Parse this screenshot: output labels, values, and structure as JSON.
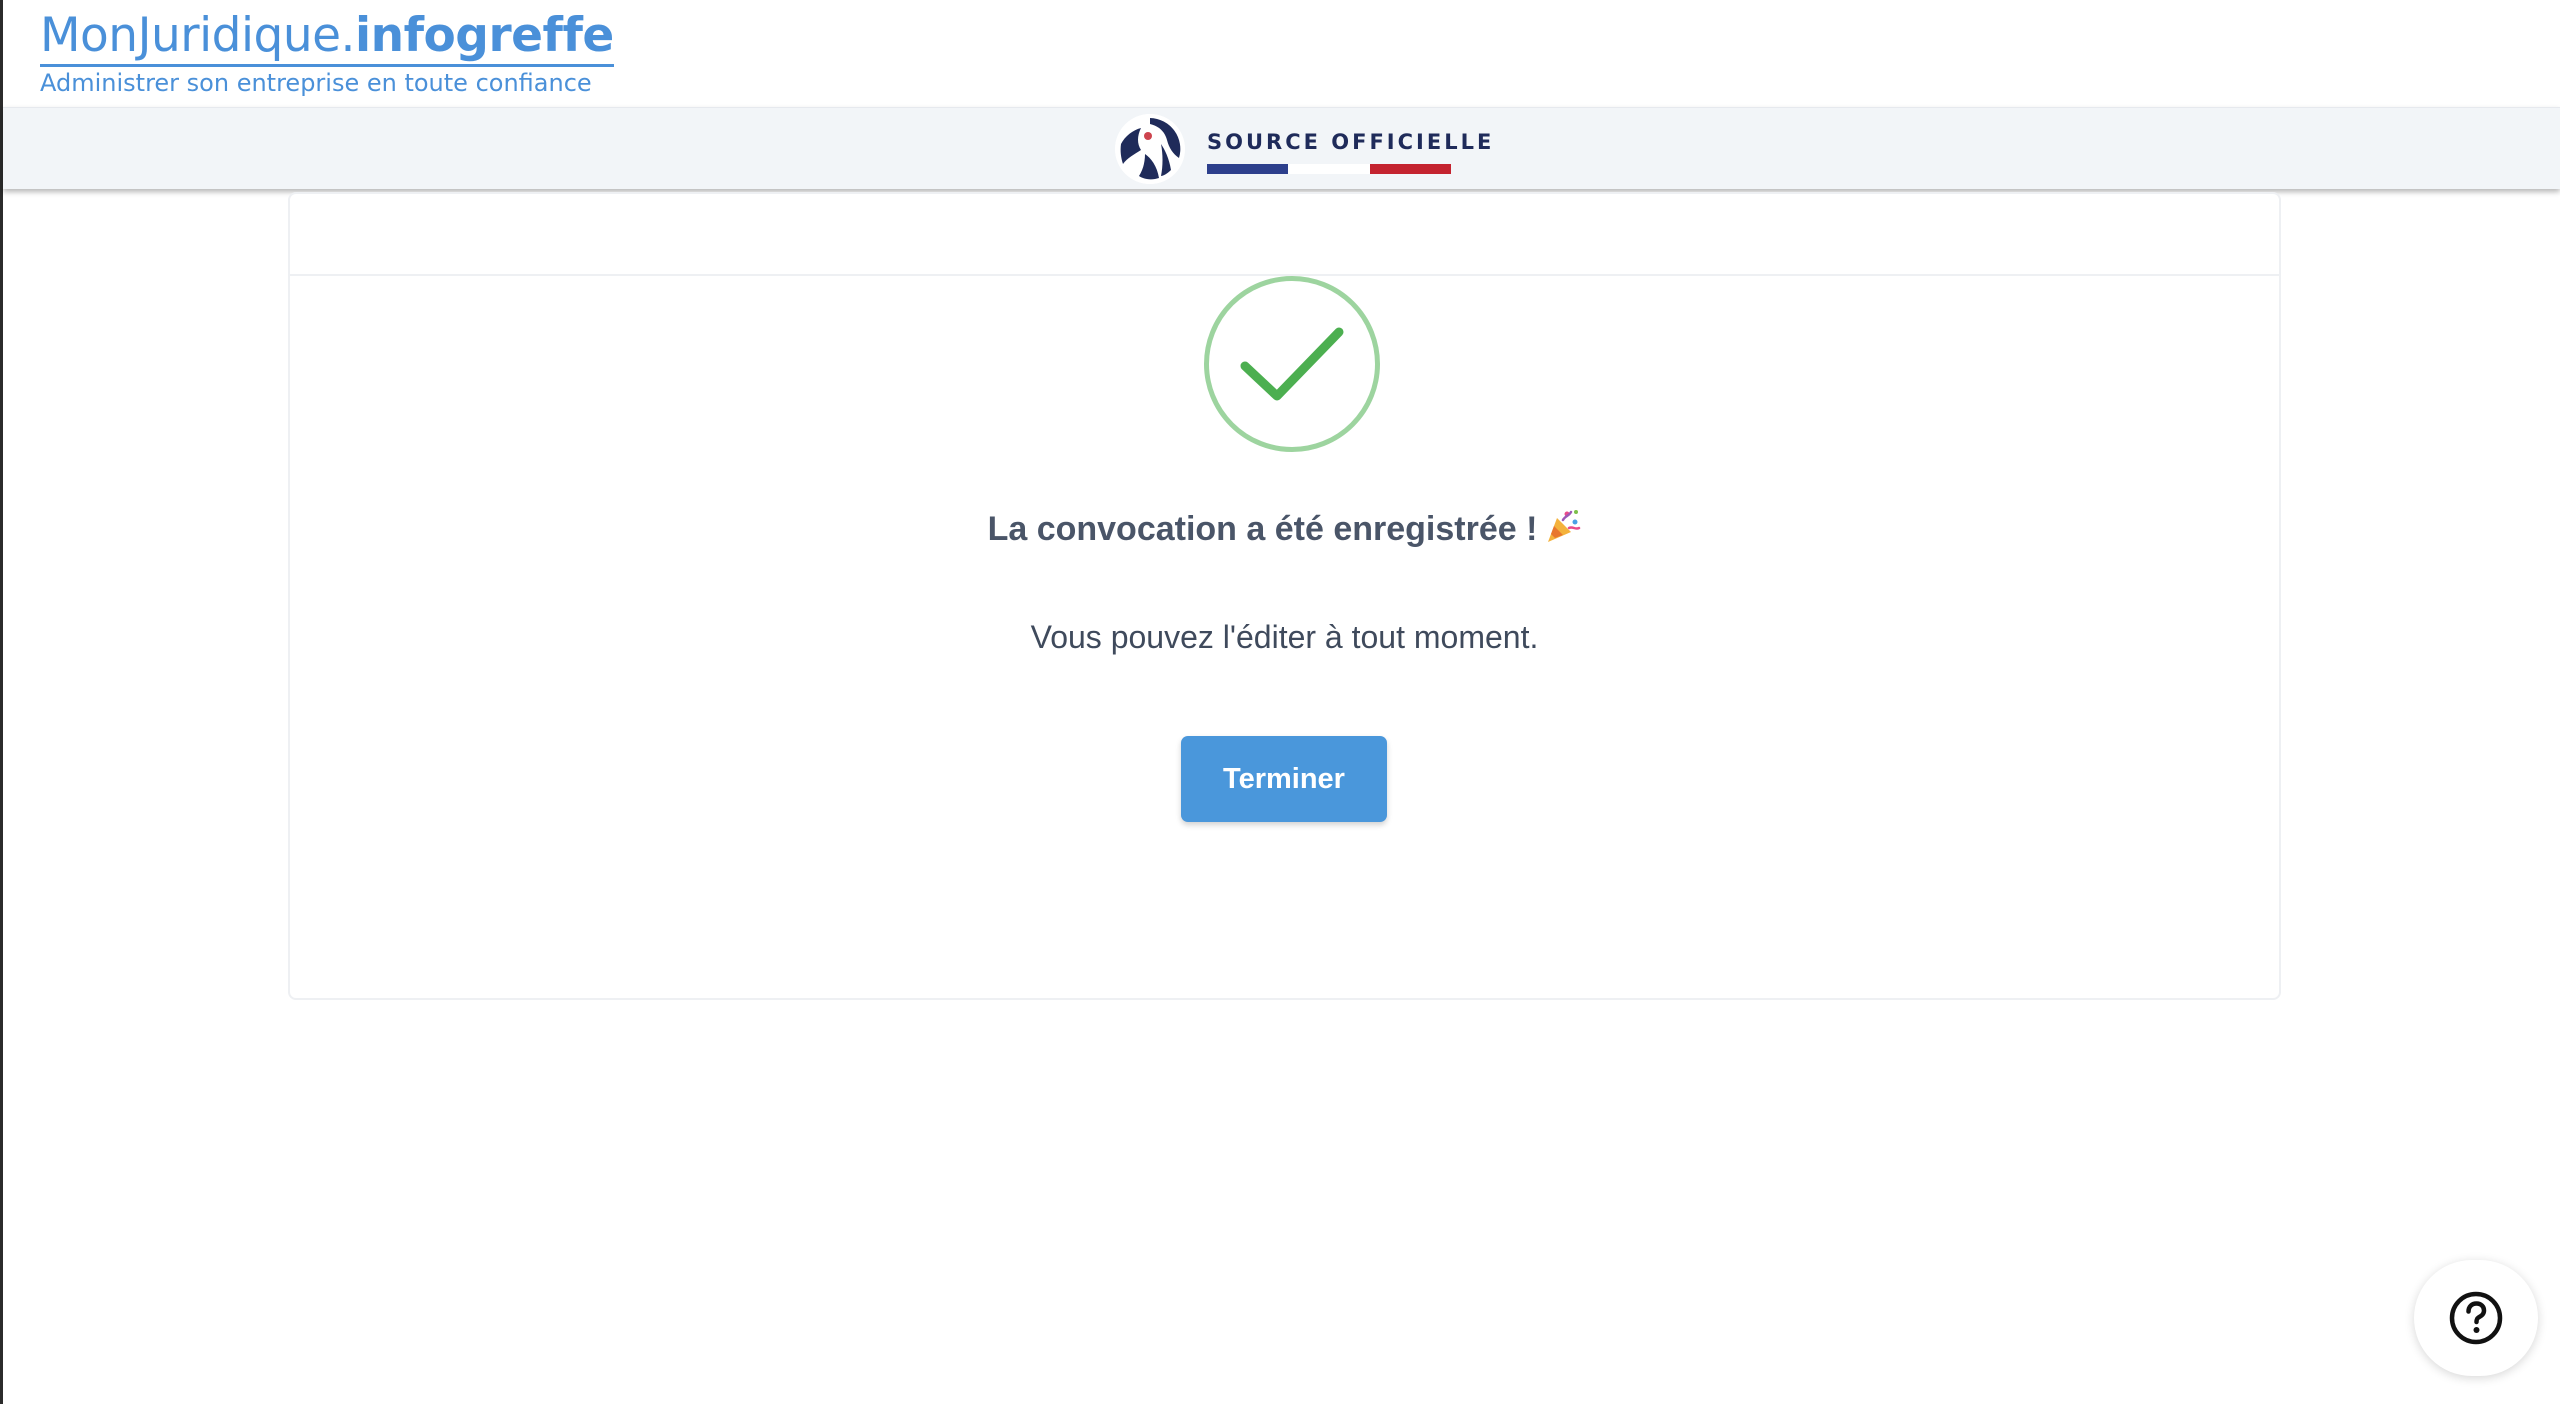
{
  "header": {
    "brand_name_part1": "MonJuridique.",
    "brand_name_part2": "infogreffe",
    "tagline": "Administrer son entreprise en toute confiance"
  },
  "official_bar": {
    "label": "SOURCE OFFICIELLE"
  },
  "confirmation": {
    "title": "La convocation a été enregistrée !",
    "message": "Vous pouvez l'éditer à tout moment.",
    "finish_label": "Terminer"
  },
  "help": {
    "icon": "question-circle-icon"
  },
  "colors": {
    "brand": "#4a90d9",
    "success": "#4caf50",
    "primary_button": "#4a97db",
    "text": "#4a5568"
  }
}
